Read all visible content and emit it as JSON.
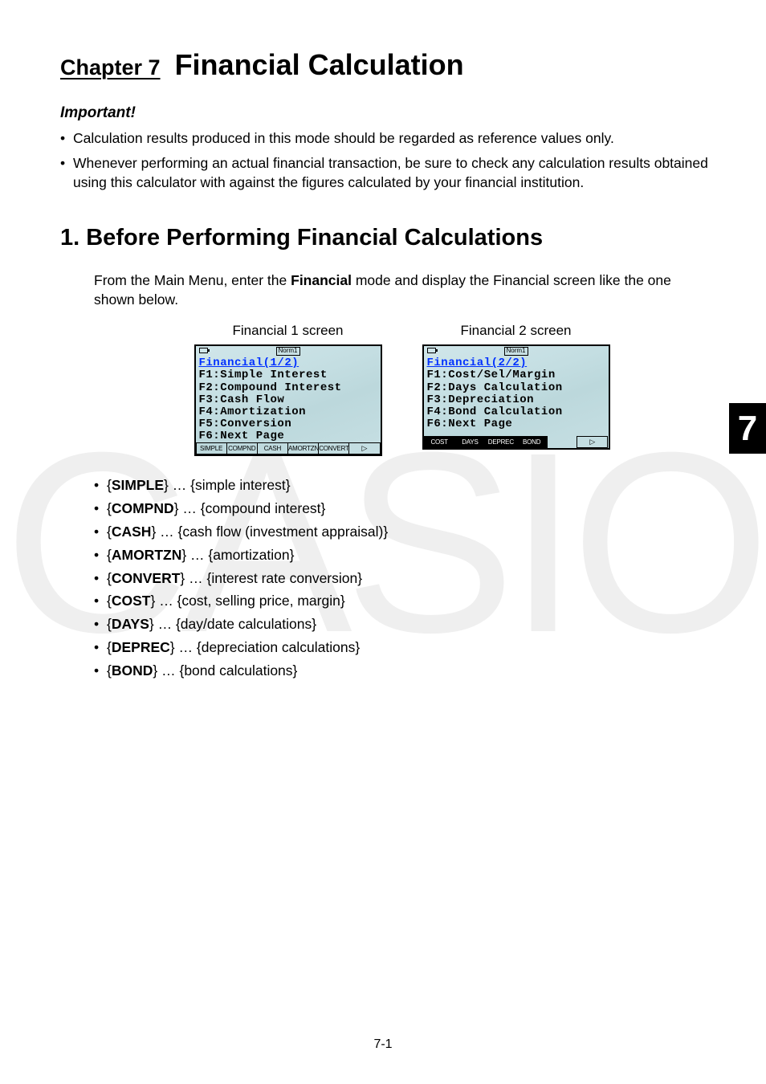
{
  "watermark": "CASIO",
  "chapter": {
    "label": "Chapter 7",
    "title": "Financial Calculation"
  },
  "important_heading": "Important!",
  "important_bullets": [
    "Calculation results produced in this mode should be regarded as reference values only.",
    "Whenever performing an actual financial transaction, be sure to check any calculation results obtained using this calculator with against the figures calculated by your financial institution."
  ],
  "section_heading": "1. Before Performing Financial Calculations",
  "intro_a": "From the Main Menu, enter the ",
  "intro_bold": "Financial",
  "intro_b": " mode and display the Financial screen like the one shown below.",
  "screens": {
    "left": {
      "caption": "Financial 1 screen",
      "status": "Norm1",
      "title": "Financial(1/2)",
      "lines": [
        "F1:Simple Interest",
        "F2:Compound Interest",
        "F3:Cash Flow",
        "F4:Amortization",
        "F5:Conversion",
        "F6:Next Page"
      ],
      "fkeys": [
        "SIMPLE",
        "COMPND",
        "CASH",
        "AMORTZN",
        "CONVERT"
      ],
      "arrow": "▷"
    },
    "right": {
      "caption": "Financial 2 screen",
      "status": "Norm1",
      "title": "Financial(2/2)",
      "lines": [
        "F1:Cost/Sel/Margin",
        "F2:Days Calculation",
        "F3:Depreciation",
        "F4:Bond Calculation",
        "",
        "F6:Next Page"
      ],
      "fkeys": [
        "COST",
        "DAYS",
        "DEPREC",
        "BOND"
      ],
      "arrow": "▷"
    }
  },
  "fn_list": [
    {
      "key": "SIMPLE",
      "desc": "simple interest"
    },
    {
      "key": "COMPND",
      "desc": "compound interest"
    },
    {
      "key": "CASH",
      "desc": "cash flow (investment appraisal)"
    },
    {
      "key": "AMORTZN",
      "desc": "amortization"
    },
    {
      "key": "CONVERT",
      "desc": "interest rate conversion"
    },
    {
      "key": "COST",
      "desc": "cost, selling price, margin"
    },
    {
      "key": "DAYS",
      "desc": "day/date calculations"
    },
    {
      "key": "DEPREC",
      "desc": "depreciation calculations"
    },
    {
      "key": "BOND",
      "desc": "bond calculations"
    }
  ],
  "side_tab": "7",
  "pagenum": "7-1"
}
